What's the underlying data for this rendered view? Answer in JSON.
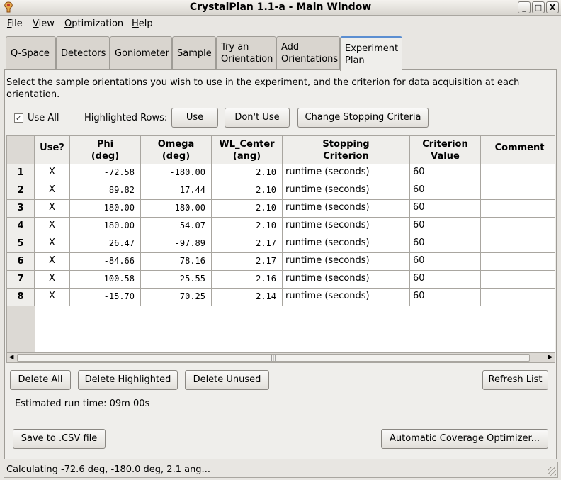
{
  "window": {
    "title": "CrystalPlan 1.1-a - Main Window",
    "controls": [
      "_",
      "□",
      "X"
    ]
  },
  "menu": [
    "File",
    "View",
    "Optimization",
    "Help"
  ],
  "tabs": [
    {
      "label": "Q-Space"
    },
    {
      "label": "Detectors"
    },
    {
      "label": "Goniometer"
    },
    {
      "label": "Sample"
    },
    {
      "label": "Try an\nOrientation"
    },
    {
      "label": "Add\nOrientations"
    },
    {
      "label": "Experiment\nPlan",
      "active": true
    }
  ],
  "experiment": {
    "instructions": "Select the sample orientations you wish to use in the experiment, and the criterion for data acquisition at each orientation.",
    "use_all_label": "Use All",
    "use_all_checked": true,
    "checkmark": "✓",
    "highlighted_rows_label": "Highlighted Rows:",
    "use_button": "Use",
    "dont_use_button": "Don't Use",
    "change_stopping_button": "Change Stopping Criteria",
    "columns": [
      "Use?",
      "Phi\n(deg)",
      "Omega\n(deg)",
      "WL_Center\n(ang)",
      "Stopping\nCriterion",
      "Criterion\nValue",
      "Comment"
    ],
    "rows": [
      {
        "n": "1",
        "use": "X",
        "phi": "-72.58",
        "omega": "-180.00",
        "wl": "2.10",
        "criterion": "runtime (seconds)",
        "value": "60",
        "comment": ""
      },
      {
        "n": "2",
        "use": "X",
        "phi": "89.82",
        "omega": "17.44",
        "wl": "2.10",
        "criterion": "runtime (seconds)",
        "value": "60",
        "comment": ""
      },
      {
        "n": "3",
        "use": "X",
        "phi": "-180.00",
        "omega": "180.00",
        "wl": "2.10",
        "criterion": "runtime (seconds)",
        "value": "60",
        "comment": ""
      },
      {
        "n": "4",
        "use": "X",
        "phi": "180.00",
        "omega": "54.07",
        "wl": "2.10",
        "criterion": "runtime (seconds)",
        "value": "60",
        "comment": ""
      },
      {
        "n": "5",
        "use": "X",
        "phi": "26.47",
        "omega": "-97.89",
        "wl": "2.17",
        "criterion": "runtime (seconds)",
        "value": "60",
        "comment": ""
      },
      {
        "n": "6",
        "use": "X",
        "phi": "-84.66",
        "omega": "78.16",
        "wl": "2.17",
        "criterion": "runtime (seconds)",
        "value": "60",
        "comment": ""
      },
      {
        "n": "7",
        "use": "X",
        "phi": "100.58",
        "omega": "25.55",
        "wl": "2.16",
        "criterion": "runtime (seconds)",
        "value": "60",
        "comment": ""
      },
      {
        "n": "8",
        "use": "X",
        "phi": "-15.70",
        "omega": "70.25",
        "wl": "2.14",
        "criterion": "runtime (seconds)",
        "value": "60",
        "comment": ""
      }
    ],
    "delete_all_button": "Delete All",
    "delete_highlighted_button": "Delete Highlighted",
    "delete_unused_button": "Delete Unused",
    "refresh_button": "Refresh List",
    "estimated_runtime": "Estimated run time: 09m 00s",
    "save_csv_button": "Save to .CSV file",
    "optimizer_button": "Automatic Coverage Optimizer...",
    "scrollbar": {
      "left_arrow": "◀",
      "right_arrow": "▶",
      "thumb_grip": "|||"
    }
  },
  "status": "Calculating -72.6 deg, -180.0 deg, 2.1 ang..."
}
